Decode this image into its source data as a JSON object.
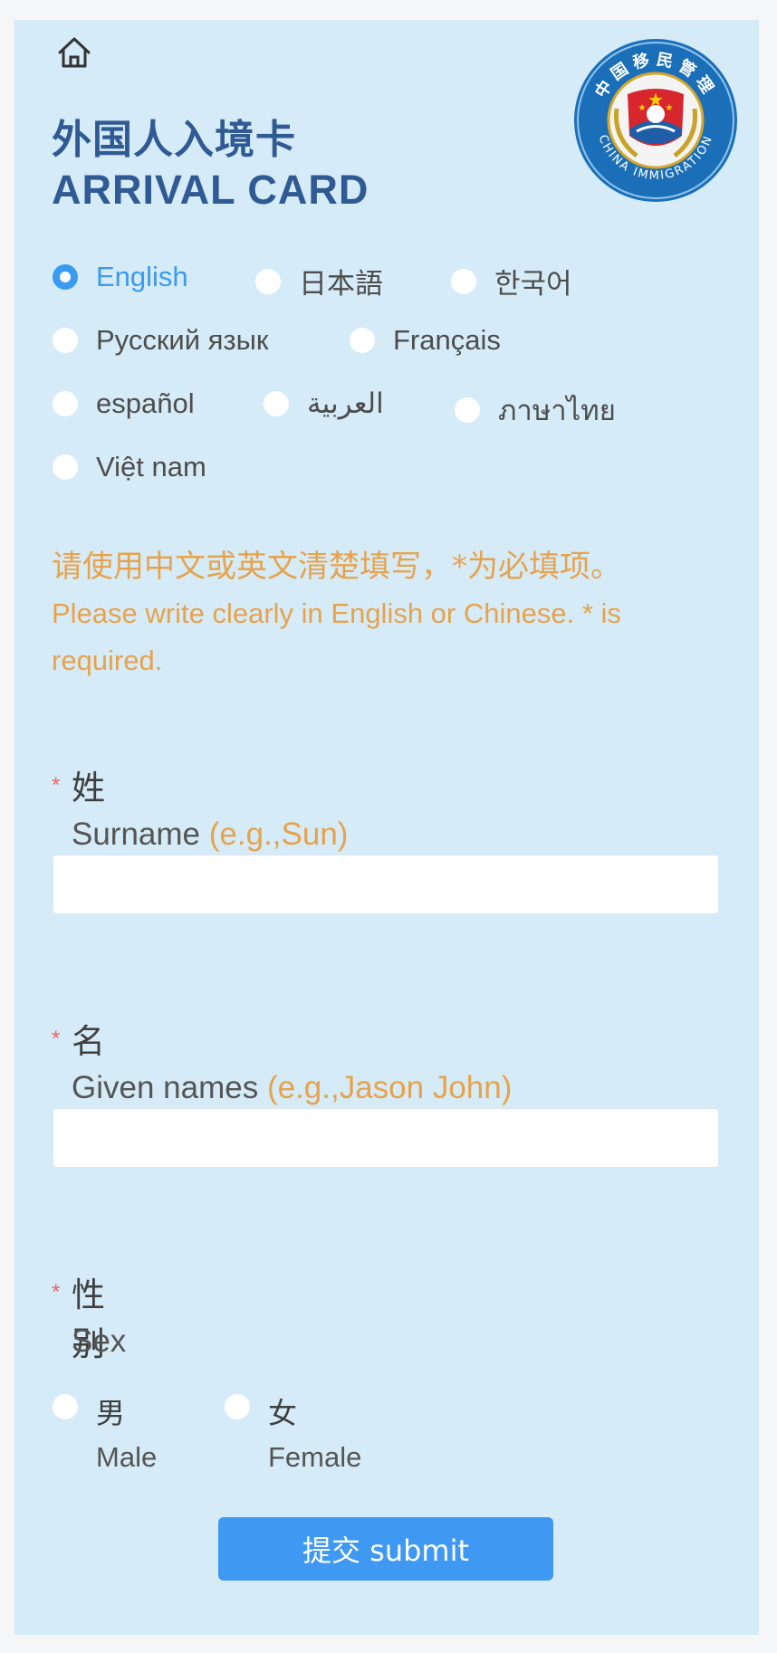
{
  "header": {
    "title_cn": "外国人入境卡",
    "title_en": "ARRIVAL CARD",
    "emblem_text_cn": "中国移民管理",
    "emblem_text_en": "CHINA IMMIGRATION"
  },
  "languages": [
    {
      "label": "English",
      "selected": true
    },
    {
      "label": "日本語",
      "selected": false
    },
    {
      "label": "한국어",
      "selected": false
    },
    {
      "label": "Русский язык",
      "selected": false
    },
    {
      "label": "Français",
      "selected": false
    },
    {
      "label": "español",
      "selected": false
    },
    {
      "label": "العربية",
      "selected": false
    },
    {
      "label": "ภาษาไทย",
      "selected": false
    },
    {
      "label": "Việt nam",
      "selected": false
    }
  ],
  "notice": {
    "cn": "请使用中文或英文清楚填写，*为必填项。",
    "en": "Please write clearly in English or Chinese. * is required."
  },
  "fields": {
    "surname": {
      "required_mark": "*",
      "label_cn": "姓",
      "label_en": "Surname",
      "hint": "(e.g.,Sun)",
      "value": ""
    },
    "given_names": {
      "required_mark": "*",
      "label_cn": "名",
      "label_en": "Given names",
      "hint": "(e.g.,Jason John)",
      "value": ""
    },
    "sex": {
      "required_mark": "*",
      "label_cn": "性别",
      "label_en": "Sex",
      "options": [
        {
          "label_cn": "男",
          "label_en": "Male",
          "selected": false
        },
        {
          "label_cn": "女",
          "label_en": "Female",
          "selected": false
        }
      ]
    }
  },
  "submit_label": "提交 submit",
  "colors": {
    "accent": "#3f98f2",
    "title": "#2f5a93",
    "notice": "#e6a34c",
    "required": "#e96565",
    "card_bg": "#d6ebf8"
  },
  "icons": {
    "home": "home-icon",
    "emblem": "china-immigration-emblem"
  }
}
